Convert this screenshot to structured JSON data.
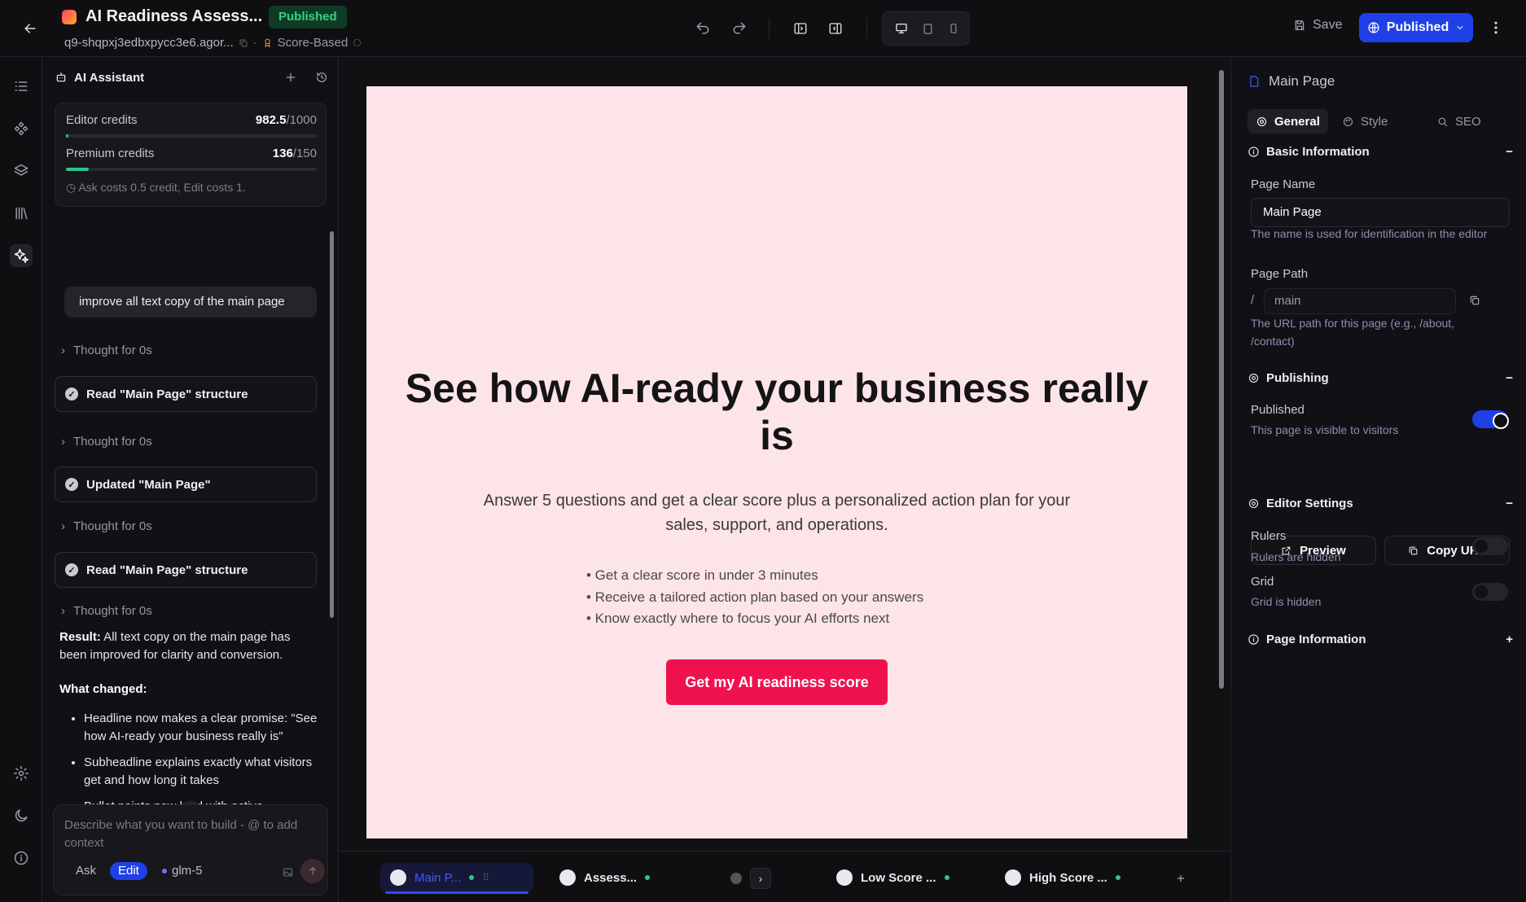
{
  "topbar": {
    "title": "AI Readiness Assess...",
    "status_badge": "Published",
    "project_id": "q9-shqpxj3edbxpycc3e6.agor...",
    "mode": "Score-Based",
    "save_label": "Save",
    "publish_label": "Published"
  },
  "assistant": {
    "title": "AI Assistant",
    "editor_credits_label": "Editor credits",
    "editor_credits_used": "982.5",
    "editor_credits_total": "/1000",
    "editor_credits_fraction": 0.01,
    "premium_credits_label": "Premium credits",
    "premium_credits_used": "136",
    "premium_credits_total": "/150",
    "premium_credits_fraction": 0.09,
    "cost_note": "Ask costs 0.5 credit, Edit costs 1.",
    "user_message": "improve all text copy of the main page",
    "thought_label": "Thought for 0s",
    "step1": "Read \"Main Page\" structure",
    "step2": "Updated \"Main Page\"",
    "step3": "Read \"Main Page\" structure",
    "result_label": "Result:",
    "result_text": " All text copy on the main page has been improved for clarity and conversion.",
    "changed_label": "What changed:",
    "changes": [
      "Headline now makes a clear promise: \"See how AI-ready your business really is\"",
      "Subheadline explains exactly what visitors get and how long it takes",
      "Bullet points now lead with active"
    ],
    "composer_placeholder": "Describe what you want to build - @ to add context",
    "ask_label": "Ask",
    "edit_label": "Edit",
    "model": "glm-5"
  },
  "canvas": {
    "headline": "See how AI-ready your business really is",
    "subheadline": "Answer 5 questions and get a clear score plus a personalized action plan for your sales, support, and operations.",
    "bullets": [
      "• Get a clear score in under 3 minutes",
      "• Receive a tailored action plan based on your answers",
      "• Know exactly where to focus your AI efforts next"
    ],
    "cta_label": "Get my AI readiness score",
    "background_color": "#fde4e8",
    "cta_color": "#f0124f"
  },
  "page_tabs": {
    "tab1": "Main P...",
    "tab2": "Assess...",
    "tab3": "Low Score ...",
    "tab4": "High Score ..."
  },
  "inspector": {
    "title": "Main Page",
    "tab_general": "General",
    "tab_style": "Style",
    "tab_seo": "SEO",
    "basic_info": "Basic Information",
    "page_name_label": "Page Name",
    "page_name_value": "Main Page",
    "page_name_help": "The name is used for identification in the editor",
    "page_path_label": "Page Path",
    "path_prefix": "/",
    "page_path_value": "main",
    "page_path_help": "The URL path for this page (e.g., /about, /contact)",
    "publishing": "Publishing",
    "published_label": "Published",
    "published_help": "This page is visible to visitors",
    "preview_label": "Preview",
    "copy_url_label": "Copy URL",
    "editor_settings": "Editor Settings",
    "rulers_label": "Rulers",
    "rulers_help": "Rulers are hidden",
    "grid_label": "Grid",
    "grid_help": "Grid is hidden",
    "page_information": "Page Information"
  }
}
